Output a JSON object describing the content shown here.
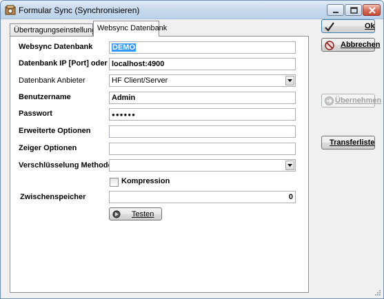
{
  "window": {
    "title": "Formular Sync (Synchronisieren)"
  },
  "tabs": [
    {
      "label": "Übertragungseinstellungen",
      "active": false
    },
    {
      "label": "Websync Datenbank",
      "active": true
    }
  ],
  "form": {
    "websync_db": {
      "label": "Websync Datenbank",
      "value": "DEMO"
    },
    "db_ip": {
      "label": "Datenbank IP [Port] oder URL",
      "value": "localhost:4900"
    },
    "db_provider": {
      "label": "Datenbank Anbieter",
      "value": "HF Client/Server"
    },
    "username": {
      "label": "Benutzername",
      "value": "Admin"
    },
    "password": {
      "label": "Passwort",
      "value": "●●●●●●"
    },
    "advanced": {
      "label": "Erweiterte Optionen",
      "value": ""
    },
    "pointer": {
      "label": "Zeiger Optionen",
      "value": ""
    },
    "encryption": {
      "label": "Verschlüsselung Methode",
      "value": ""
    },
    "compression": {
      "label": "Kompression",
      "checked": false
    },
    "cache": {
      "label": "Zwischenspeicher",
      "value": "0"
    },
    "test_button": "Testen"
  },
  "actions": {
    "ok": "Ok",
    "cancel": "Abbrechen",
    "apply": "Übernehmen",
    "transfer_list": "Transferliste"
  },
  "icons": {
    "app": "sync-app-icon",
    "ok": "checkmark-icon",
    "cancel": "no-entry-icon",
    "apply": "arrow-right-icon",
    "test": "test-icon"
  }
}
